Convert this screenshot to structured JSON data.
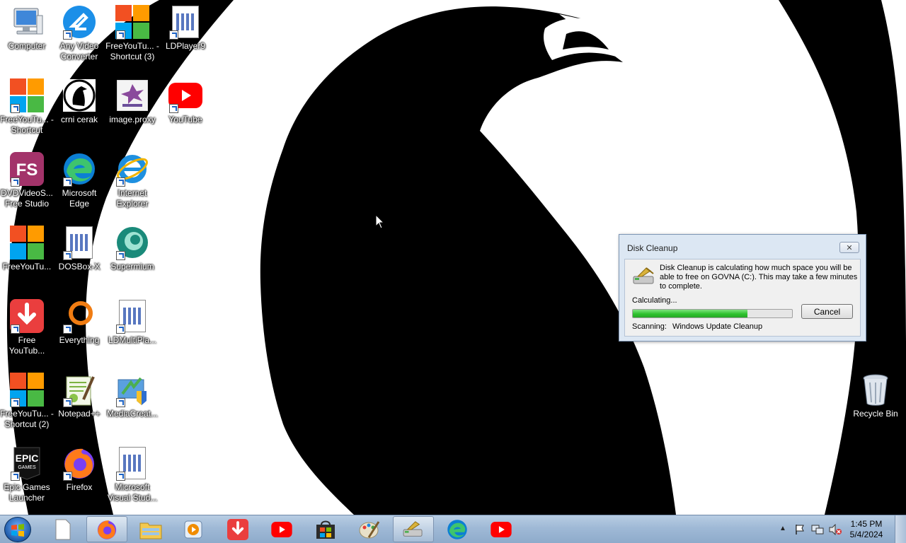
{
  "desktop": {
    "icons": [
      {
        "label": "Computer",
        "icon": "computer-icon"
      },
      {
        "label": "Any Video Converter",
        "icon": "any-video-converter-icon"
      },
      {
        "label": "FreeYouTu... - Shortcut (3)",
        "icon": "freeyoutube-icon"
      },
      {
        "label": "LDPlayer9",
        "icon": "ldplayer-icon"
      },
      {
        "label": "FreeYouTu... - Shortcut",
        "icon": "freeyoutube-icon"
      },
      {
        "label": "crni cerak",
        "icon": "crow-icon"
      },
      {
        "label": "image.proxy",
        "icon": "image-icon"
      },
      {
        "label": "YouTube",
        "icon": "youtube-icon"
      },
      {
        "label": "DVDVideoS... Free Studio",
        "icon": "free-studio-icon"
      },
      {
        "label": "Microsoft Edge",
        "icon": "edge-icon"
      },
      {
        "label": "Internet Explorer",
        "icon": "internet-explorer-icon"
      },
      {
        "label": "FreeYouTu...",
        "icon": "freeyoutube-icon"
      },
      {
        "label": "DOSBox-X",
        "icon": "dosbox-icon"
      },
      {
        "label": "Supermium",
        "icon": "supermium-icon"
      },
      {
        "label": "Free YouTub...",
        "icon": "free-youtube-download-icon"
      },
      {
        "label": "Everything",
        "icon": "everything-icon"
      },
      {
        "label": "LDMultiPla...",
        "icon": "ldmultiplayer-icon"
      },
      {
        "label": "FreeYouTu... - Shortcut (2)",
        "icon": "freeyoutube-icon"
      },
      {
        "label": "Notepad++",
        "icon": "notepadpp-icon"
      },
      {
        "label": "MediaCreat...",
        "icon": "media-creation-icon"
      },
      {
        "label": "Epic Games Launcher",
        "icon": "epic-games-icon"
      },
      {
        "label": "Firefox",
        "icon": "firefox-icon"
      },
      {
        "label": "Microsoft Visual Stud...",
        "icon": "visual-studio-icon"
      },
      {
        "label": "Recycle Bin",
        "icon": "recycle-bin-icon"
      }
    ],
    "epic_logo_text": "EPIC GAMES",
    "fs_logo_text": "FS"
  },
  "dialog": {
    "title": "Disk Cleanup",
    "message": "Disk Cleanup is calculating how much space you will be able to free on GOVNA (C:). This may take a few minutes to complete.",
    "status": "Calculating...",
    "progress_percent": 72,
    "cancel_label": "Cancel",
    "scanning_label": "Scanning:",
    "scanning_item": "Windows Update Cleanup"
  },
  "taskbar": {
    "items": [
      "file-icon",
      "firefox-icon",
      "explorer-icon",
      "media-player-icon",
      "free-youtube-download-icon",
      "youtube-icon",
      "store-icon",
      "paint-icon",
      "disk-cleanup-icon",
      "edge-icon",
      "youtube-icon"
    ],
    "active_index": [
      1,
      8
    ],
    "time": "1:45 PM",
    "date": "5/4/2024"
  },
  "colors": {
    "progress": "#2ec22e",
    "youtube_red": "#ff0000",
    "taskbar": "#9fb9d6"
  }
}
